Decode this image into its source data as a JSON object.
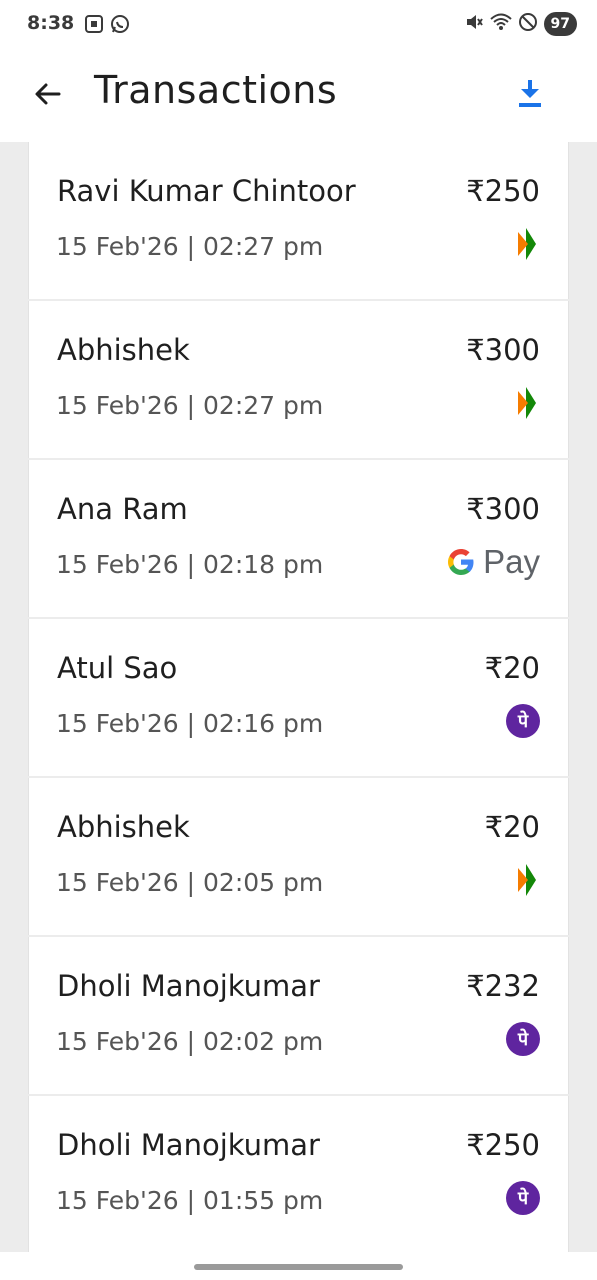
{
  "status_bar": {
    "time": "8:38",
    "battery": "97",
    "left_icons": [
      "screenshot-icon",
      "whatsapp-icon"
    ],
    "right_icons": [
      "mute-icon",
      "wifi-icon",
      "do-not-disturb-icon"
    ]
  },
  "header": {
    "title": "Transactions",
    "back_icon": "arrow-left-icon",
    "download_icon": "download-icon",
    "accent_color": "#1a73e8"
  },
  "transactions": [
    {
      "name": "Ravi Kumar Chintoor",
      "amount": "₹250",
      "date": "15 Feb'26 | 02:27 pm",
      "method": "bhim-upi-icon"
    },
    {
      "name": "Abhishek",
      "amount": "₹300",
      "date": "15 Feb'26 | 02:27 pm",
      "method": "bhim-upi-icon"
    },
    {
      "name": "Ana Ram",
      "amount": "₹300",
      "date": "15 Feb'26 | 02:18 pm",
      "method": "google-pay-icon",
      "method_label": "Pay"
    },
    {
      "name": "Atul Sao",
      "amount": "₹20",
      "date": "15 Feb'26 | 02:16 pm",
      "method": "phonepe-icon",
      "method_label": "पे"
    },
    {
      "name": "Abhishek",
      "amount": "₹20",
      "date": "15 Feb'26 | 02:05 pm",
      "method": "bhim-upi-icon"
    },
    {
      "name": "Dholi Manojkumar",
      "amount": "₹232",
      "date": "15 Feb'26 | 02:02 pm",
      "method": "phonepe-icon",
      "method_label": "पे"
    },
    {
      "name": "Dholi Manojkumar",
      "amount": "₹250",
      "date": "15 Feb'26 | 01:55 pm",
      "method": "phonepe-icon",
      "method_label": "पे"
    }
  ]
}
